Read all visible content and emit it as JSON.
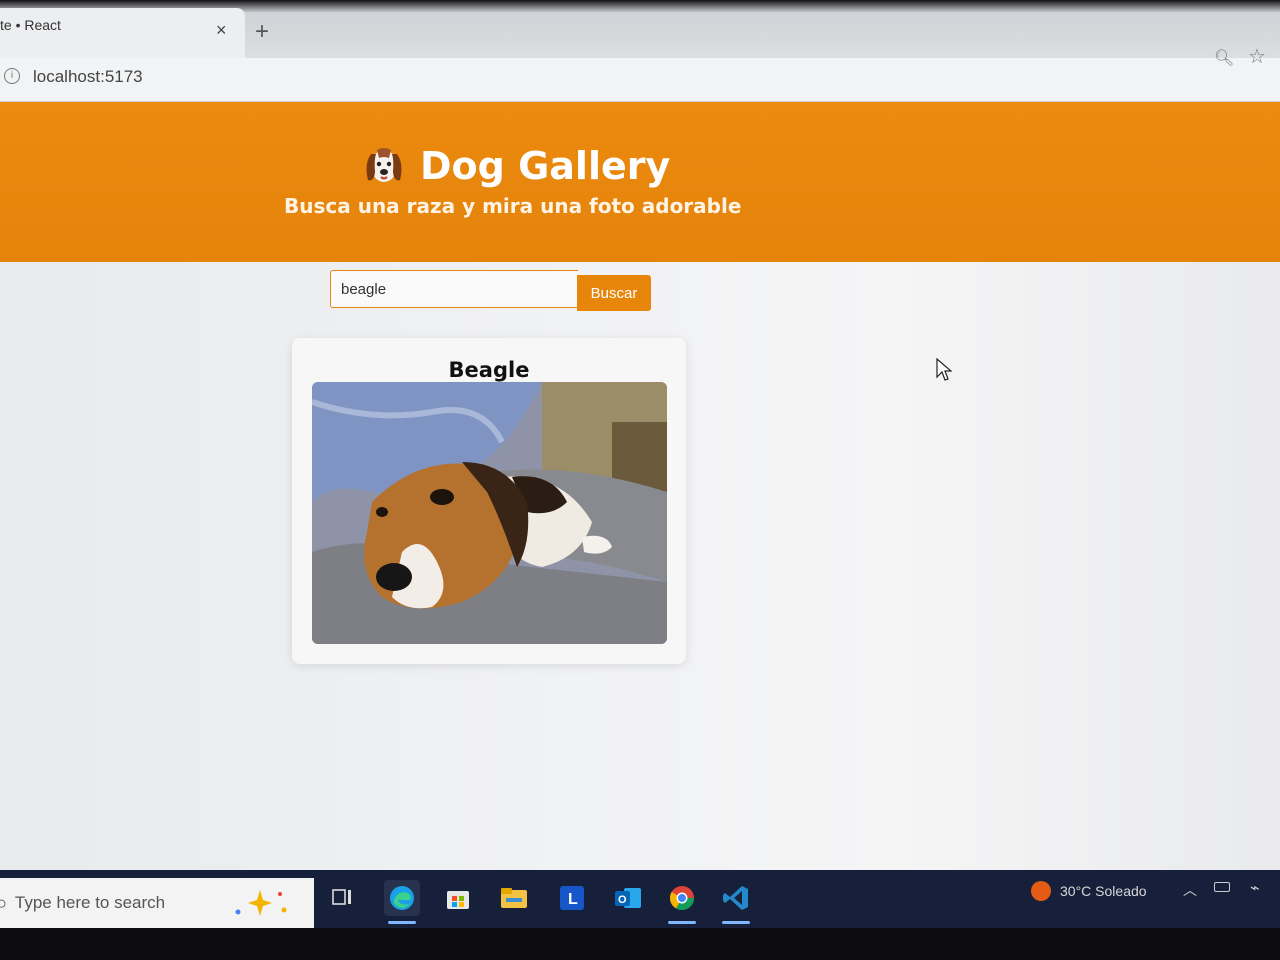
{
  "browser": {
    "tab_title": "te • React",
    "tab_close": "×",
    "new_tab": "+",
    "url": "localhost:5173"
  },
  "header": {
    "title": "Dog Gallery",
    "subtitle": "Busca una raza y mira una foto adorable"
  },
  "search": {
    "value": "beagle",
    "button_label": "Buscar"
  },
  "result": {
    "breed": "Beagle"
  },
  "taskbar": {
    "search_placeholder": "Type here to search",
    "apps": [
      "task-view",
      "edge",
      "store",
      "file-explorer",
      "l-app",
      "outlook",
      "chrome",
      "vscode"
    ],
    "weather_text": "30°C  Soleado"
  },
  "colors": {
    "accent": "#e8850b",
    "header_bg": "#e5840a",
    "taskbar_bg": "#16203a"
  }
}
